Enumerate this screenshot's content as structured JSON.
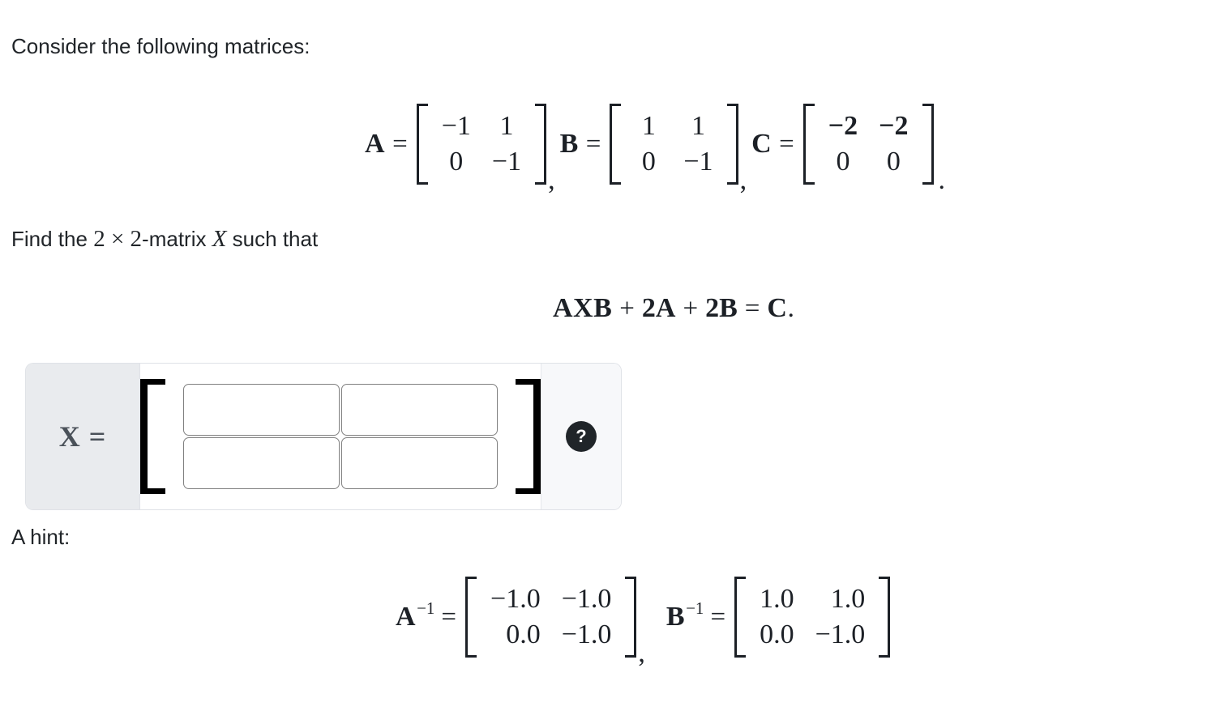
{
  "intro": {
    "text": "Consider the following matrices:"
  },
  "given_matrices": [
    {
      "name": "A",
      "equals": "=",
      "rows": [
        [
          "−1",
          "1"
        ],
        [
          "0",
          "−1"
        ]
      ],
      "separator": ","
    },
    {
      "name": "B",
      "equals": "=",
      "rows": [
        [
          "1",
          "1"
        ],
        [
          "0",
          "−1"
        ]
      ],
      "separator": ","
    },
    {
      "name": "C",
      "equals": "=",
      "rows": [
        [
          "−2",
          "−2"
        ],
        [
          "0",
          "0"
        ]
      ],
      "separator": "."
    }
  ],
  "task": {
    "prefix": "Find the",
    "dimension": "2 × 2",
    "middle": "-matrix",
    "variable": "X",
    "suffix": "such that"
  },
  "equation": {
    "lhs_term1": "AXB",
    "plus1": "+",
    "lhs_term2": "2A",
    "plus2": "+",
    "lhs_term3": "2B",
    "equals": "=",
    "rhs": "C",
    "period": "."
  },
  "answer_widget": {
    "label": "X =",
    "bracket_left": "[",
    "bracket_right": "]",
    "inputs": [
      {
        "name": "x11",
        "value": "",
        "placeholder": ""
      },
      {
        "name": "x12",
        "value": "",
        "placeholder": ""
      },
      {
        "name": "x21",
        "value": "",
        "placeholder": ""
      },
      {
        "name": "x22",
        "value": "",
        "placeholder": ""
      }
    ],
    "help_icon": "question-mark-icon",
    "help_label": "?"
  },
  "hint": {
    "heading": "A hint:",
    "matrices": [
      {
        "name": "A",
        "exponent": "−1",
        "equals": "=",
        "rows": [
          [
            "−1.0",
            "−1.0"
          ],
          [
            "0.0",
            "−1.0"
          ]
        ],
        "separator": ","
      },
      {
        "name": "B",
        "exponent": "−1",
        "equals": "=",
        "rows": [
          [
            "1.0",
            "1.0"
          ],
          [
            "0.0",
            "−1.0"
          ]
        ],
        "separator": ""
      }
    ]
  },
  "colors": {
    "page_background": "#ffffff",
    "text": "#212529",
    "math_text": "#1c2026",
    "widget_label_bg": "#e9ebee",
    "widget_label_text": "#4a5159",
    "widget_help_bg": "#f7f8fa",
    "help_circle": "#202529",
    "input_border": "#808080",
    "bracket": "#000000"
  }
}
